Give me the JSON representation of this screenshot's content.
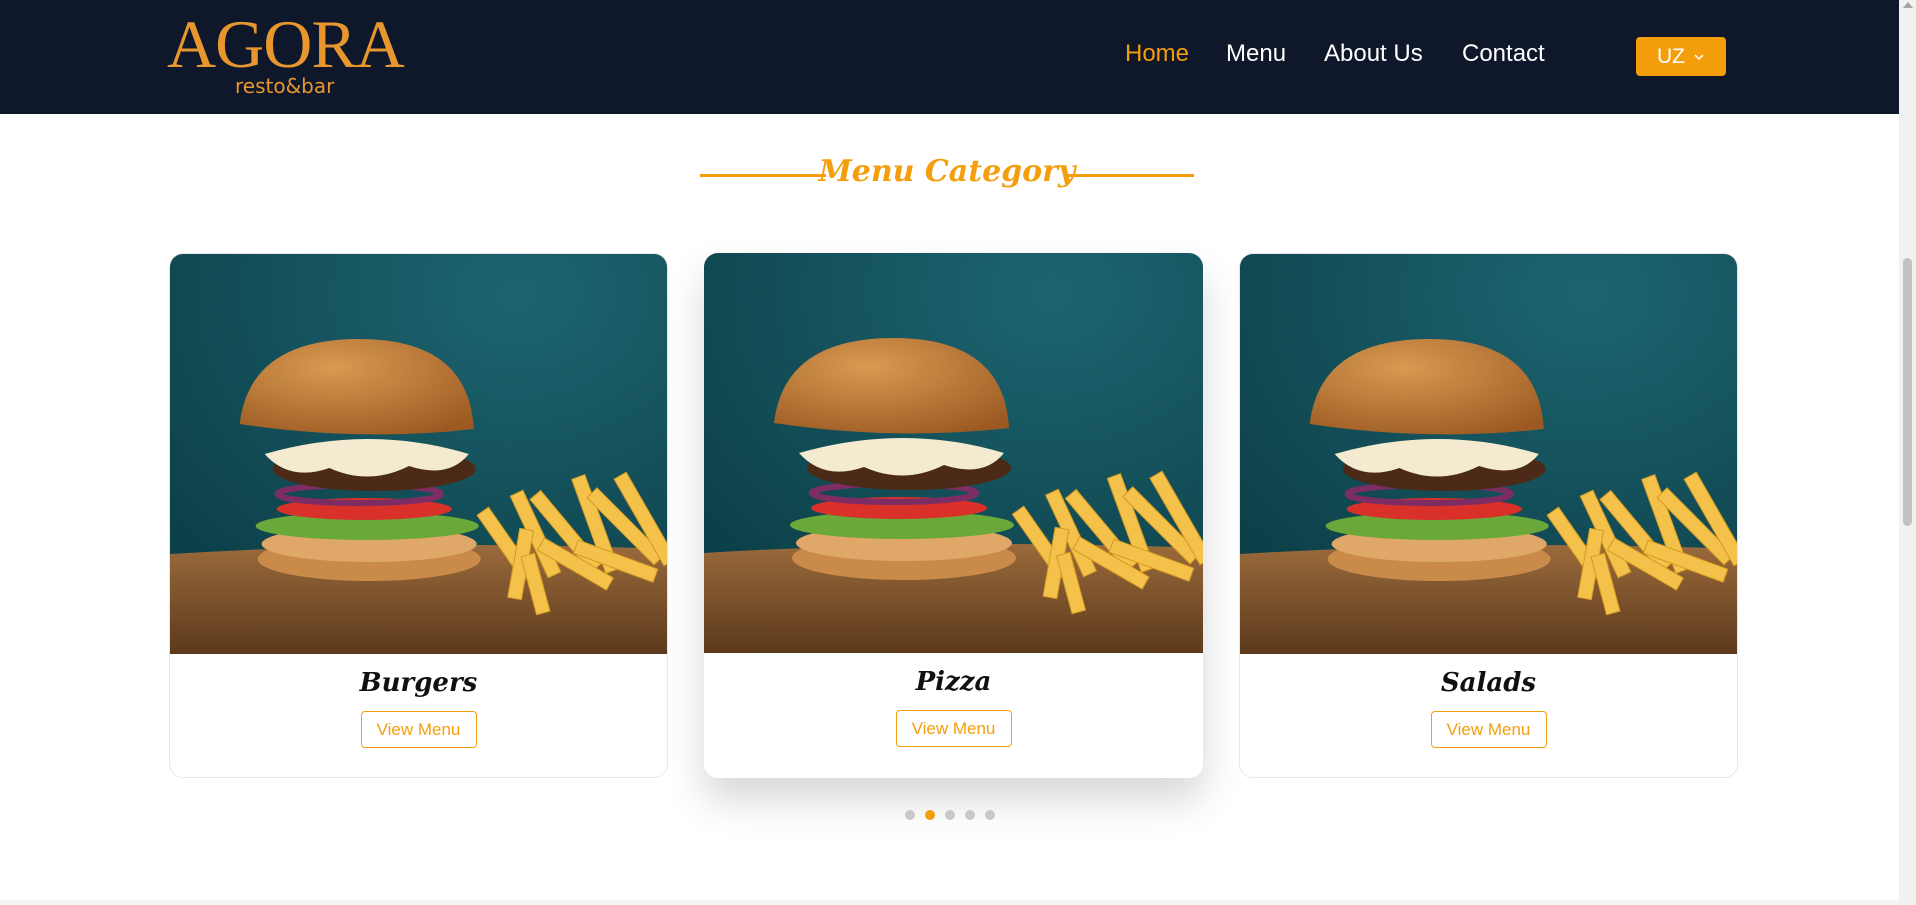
{
  "header": {
    "logo": {
      "name": "AGORA",
      "subtitle": "resto&bar"
    },
    "nav": [
      {
        "label": "Home",
        "active": true
      },
      {
        "label": "Menu",
        "active": false
      },
      {
        "label": "About Us",
        "active": false
      },
      {
        "label": "Contact",
        "active": false
      }
    ],
    "language": {
      "selected": "UZ",
      "icon": "chevron-down-icon"
    }
  },
  "section": {
    "title": "Menu Category"
  },
  "categories": [
    {
      "name": "Burgers",
      "button": "View Menu",
      "image": "burger-and-fries-photo",
      "featured": false
    },
    {
      "name": "Pizza",
      "button": "View Menu",
      "image": "burger-and-fries-photo",
      "featured": true
    },
    {
      "name": "Salads",
      "button": "View Menu",
      "image": "burger-and-fries-photo",
      "featured": false
    }
  ],
  "carousel": {
    "pages": 5,
    "active_page": 2
  },
  "colors": {
    "header_bg": "#0f172a",
    "accent": "#f59e0b",
    "text_white": "#ffffff",
    "dot_inactive": "#c9c9c9"
  }
}
